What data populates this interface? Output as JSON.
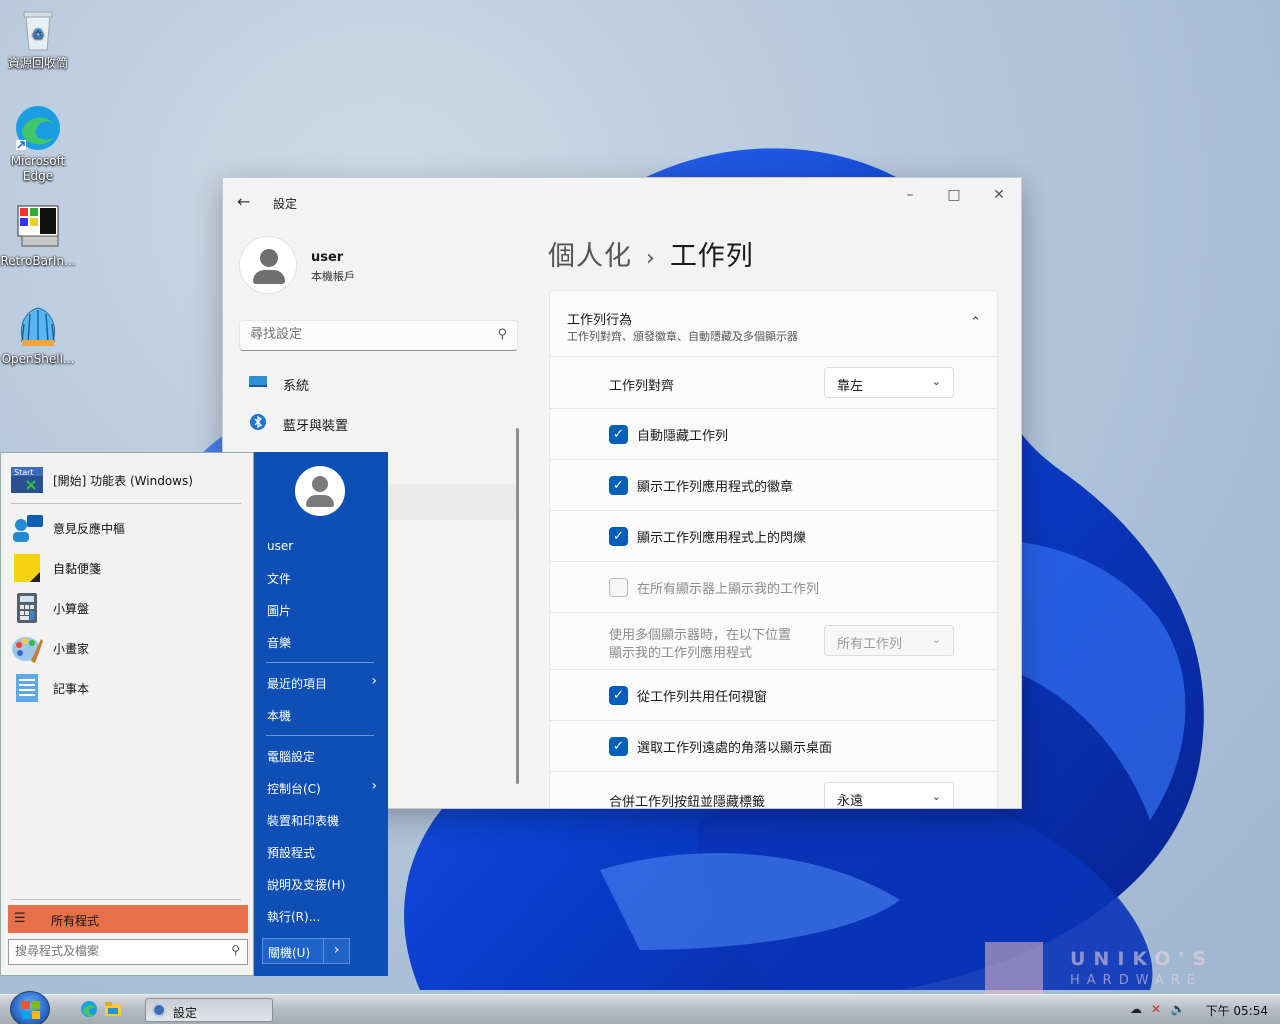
{
  "desktop": {
    "icons": [
      {
        "label": "資源回收筒"
      },
      {
        "label": "Microsoft Edge"
      },
      {
        "label": "RetroBarIn..."
      },
      {
        "label": "OpenShell..."
      }
    ]
  },
  "settings": {
    "title": "設定",
    "user": {
      "name": "user",
      "account": "本機帳戶"
    },
    "search_placeholder": "尋找設定",
    "nav": [
      {
        "label": "系統",
        "icon": "monitor-icon"
      },
      {
        "label": "藍牙與裝置",
        "icon": "bluetooth-icon"
      }
    ],
    "breadcrumb": {
      "parent": "個人化",
      "separator": "›",
      "current": "工作列"
    },
    "section": {
      "title": "工作列行為",
      "subtitle": "工作列對齊、頒發徽章、自動隱藏及多個顯示器"
    },
    "rows": [
      {
        "type": "dropdown",
        "label": "工作列對齊",
        "value": "靠左",
        "enabled": true
      },
      {
        "type": "checkbox",
        "label": "自動隱藏工作列",
        "checked": true,
        "enabled": true
      },
      {
        "type": "checkbox",
        "label": "顯示工作列應用程式的徽章",
        "checked": true,
        "enabled": true
      },
      {
        "type": "checkbox",
        "label": "顯示工作列應用程式上的閃爍",
        "checked": true,
        "enabled": true
      },
      {
        "type": "checkbox",
        "label": "在所有顯示器上顯示我的工作列",
        "checked": false,
        "enabled": false
      },
      {
        "type": "dropdown2",
        "label_line1": "使用多個顯示器時，在以下位置",
        "label_line2": "顯示我的工作列應用程式",
        "value": "所有工作列",
        "enabled": false
      },
      {
        "type": "checkbox",
        "label": "從工作列共用任何視窗",
        "checked": true,
        "enabled": true
      },
      {
        "type": "checkbox",
        "label": "選取工作列遠處的角落以顯示桌面",
        "checked": true,
        "enabled": true
      },
      {
        "type": "dropdown",
        "label": "合併工作列按鈕並隱藏標籤",
        "value": "永遠",
        "enabled": true
      }
    ]
  },
  "start_menu": {
    "pinned": {
      "label": "[開始] 功能表 (Windows)",
      "icon_text": "Start"
    },
    "programs": [
      {
        "label": "意見反應中樞"
      },
      {
        "label": "自黏便箋"
      },
      {
        "label": "小算盤"
      },
      {
        "label": "小畫家"
      },
      {
        "label": "記事本"
      }
    ],
    "all_programs": "所有程式",
    "search_placeholder": "搜尋程式及檔案",
    "right": {
      "user": "user",
      "links1": [
        "文件",
        "圖片",
        "音樂"
      ],
      "links2": [
        "最近的項目",
        "本機"
      ],
      "links3": [
        "電腦設定",
        "控制台(C)",
        "裝置和印表機",
        "預設程式",
        "說明及支援(H)",
        "執行(R)..."
      ],
      "shutdown": "關機(U)"
    }
  },
  "taskbar": {
    "task_label": "設定",
    "time": "下午 05:54"
  },
  "watermark": {
    "line1": "UNIKO'S",
    "line2": "HARDWARE"
  }
}
